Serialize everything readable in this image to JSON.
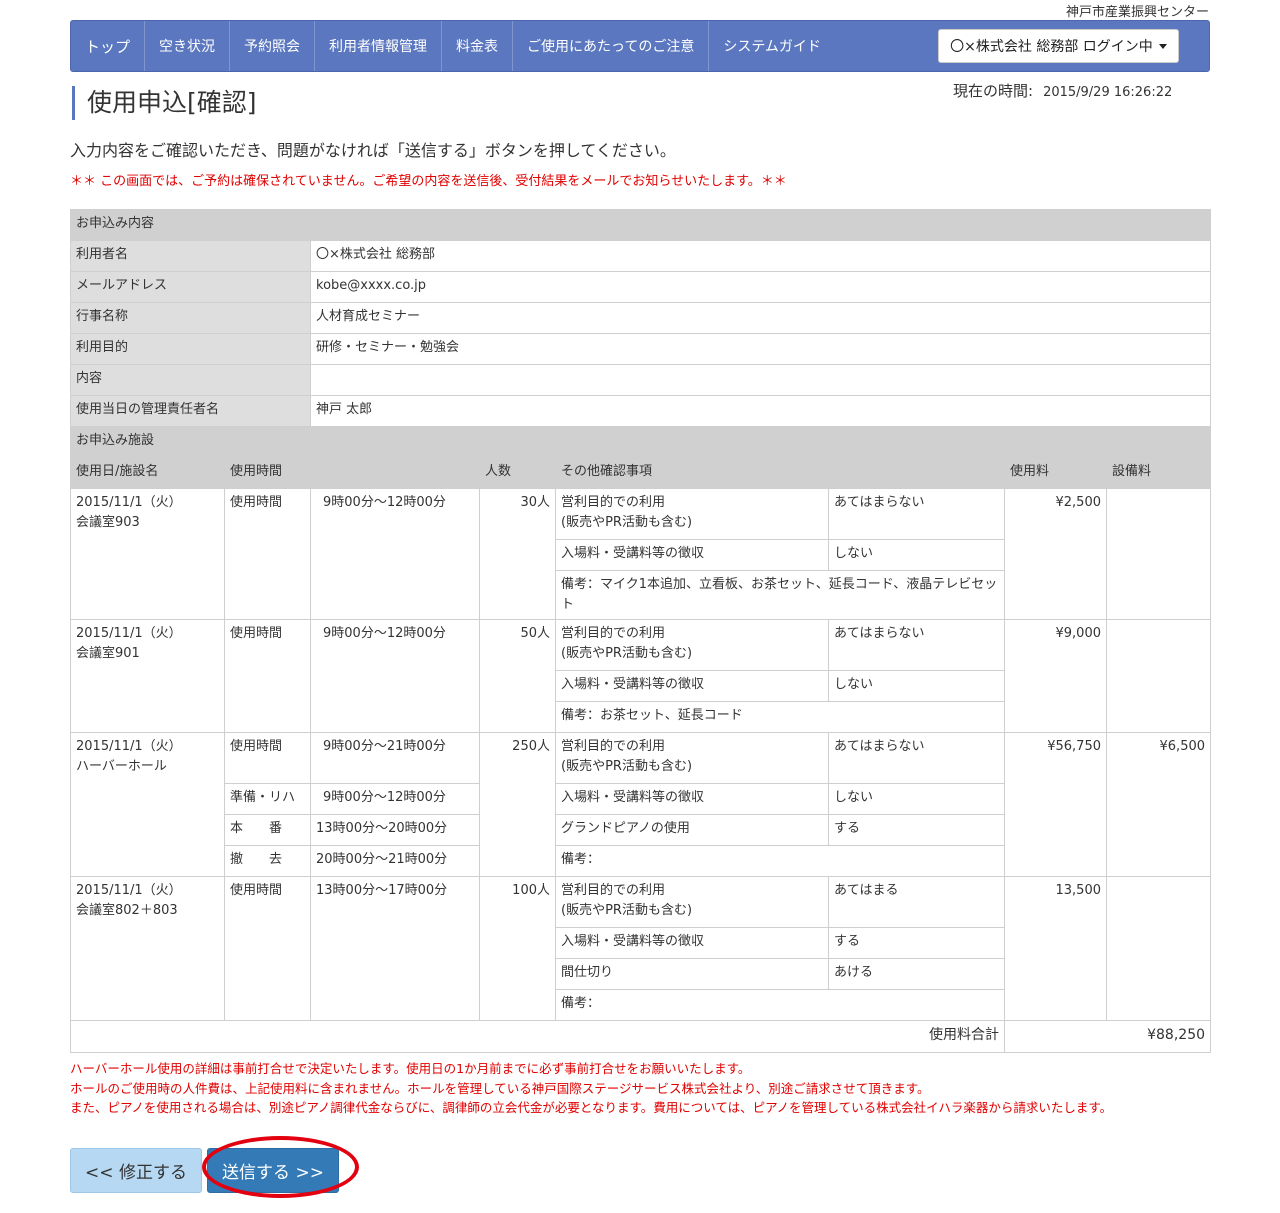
{
  "header": {
    "org_name": "神戸市産業振興センター",
    "nav": [
      "トップ",
      "空き状況",
      "予約照会",
      "利用者情報管理",
      "料金表",
      "ご使用にあたってのご注意",
      "システムガイド"
    ],
    "login_label": "〇×株式会社 総務部 ログイン中"
  },
  "clock": {
    "label": "現在の時間:",
    "value": "2015/9/29 16:26:22"
  },
  "page": {
    "title": "使用申込[確認]",
    "intro": "入力内容をご確認いただき、問題がなければ「送信する」ボタンを押してください。",
    "warning": "＊＊ この画面では、ご予約は確保されていません。ご希望の内容を送信後、受付結果をメールでお知らせいたします。＊＊"
  },
  "application": {
    "section_title": "お申込み内容",
    "fields": [
      {
        "label": "利用者名",
        "value": "〇×株式会社 総務部"
      },
      {
        "label": "メールアドレス",
        "value": "kobe@xxxx.co.jp"
      },
      {
        "label": "行事名称",
        "value": "人材育成セミナー"
      },
      {
        "label": "利用目的",
        "value": "研修・セミナー・勉強会"
      },
      {
        "label": "内容",
        "value": ""
      },
      {
        "label": "使用当日の管理責任者名",
        "value": "神戸 太郎"
      }
    ]
  },
  "facilities": {
    "section_title": "お申込み施設",
    "columns": [
      "使用日/施設名",
      "使用時間",
      "人数",
      "その他確認事項",
      "使用料",
      "設備料"
    ],
    "rows": [
      {
        "date": "2015/11/1（火）",
        "facility": "会議室903",
        "times": [
          {
            "label": "使用時間",
            "value": "9時00分～12時00分"
          }
        ],
        "people": "30人",
        "checks": [
          {
            "label": "営利目的での利用",
            "sub": "(販売やPR活動も含む)",
            "value": "あてはまらない"
          },
          {
            "label": "入場料・受講料等の徴収",
            "value": "しない"
          }
        ],
        "remarks": "備考：マイク1本追加、立看板、お茶セット、延長コード、液晶テレビセット",
        "fee": "¥2,500",
        "equip_fee": ""
      },
      {
        "date": "2015/11/1（火）",
        "facility": "会議室901",
        "times": [
          {
            "label": "使用時間",
            "value": "9時00分～12時00分"
          }
        ],
        "people": "50人",
        "checks": [
          {
            "label": "営利目的での利用",
            "sub": "(販売やPR活動も含む)",
            "value": "あてはまらない"
          },
          {
            "label": "入場料・受講料等の徴収",
            "value": "しない"
          }
        ],
        "remarks": "備考：お茶セット、延長コード",
        "fee": "¥9,000",
        "equip_fee": ""
      },
      {
        "date": "2015/11/1（火）",
        "facility": "ハーバーホール",
        "times": [
          {
            "label": "使用時間",
            "value": "9時00分～21時00分"
          },
          {
            "label": "準備・リハ",
            "value": "9時00分～12時00分"
          },
          {
            "label": "本　　番",
            "value": "13時00分～20時00分"
          },
          {
            "label": "撤　　去",
            "value": "20時00分～21時00分"
          }
        ],
        "people": "250人",
        "checks": [
          {
            "label": "営利目的での利用",
            "sub": "(販売やPR活動も含む)",
            "value": "あてはまらない"
          },
          {
            "label": "入場料・受講料等の徴収",
            "value": "しない"
          },
          {
            "label": "グランドピアノの使用",
            "value": "する"
          }
        ],
        "remarks": "備考：",
        "fee": "¥56,750",
        "equip_fee": "¥6,500"
      },
      {
        "date": "2015/11/1（火）",
        "facility": "会議室802＋803",
        "times": [
          {
            "label": "使用時間",
            "value": "13時00分～17時00分"
          }
        ],
        "people": "100人",
        "checks": [
          {
            "label": "営利目的での利用",
            "sub": "(販売やPR活動も含む)",
            "value": "あてはまる"
          },
          {
            "label": "入場料・受講料等の徴収",
            "value": "する"
          },
          {
            "label": "間仕切り",
            "value": "あける"
          }
        ],
        "remarks": "備考：",
        "fee": "13,500",
        "equip_fee": ""
      }
    ],
    "total_label": "使用料合計",
    "total_value": "¥88,250"
  },
  "notes": [
    "ハーバーホール使用の詳細は事前打合せで決定いたします。使用日の1か月前までに必ず事前打合せをお願いいたします。",
    "ホールのご使用時の人件費は、上記使用料に含まれません。ホールを管理している神戸国際ステージサービス株式会社より、別途ご請求させて頂きます。",
    "また、ピアノを使用される場合は、別途ピアノ調律代金ならびに、調律師の立会代金が必要となります。費用については、ピアノを管理している株式会社イハラ楽器から請求いたします。"
  ],
  "buttons": {
    "back": "<<  修正する",
    "submit": "送信する  >>"
  },
  "colors": {
    "nav": "#5b77bf",
    "submit": "#337ab7",
    "back": "#b6d8f2",
    "warning": "#e00000",
    "highlight": "#e3000f"
  }
}
